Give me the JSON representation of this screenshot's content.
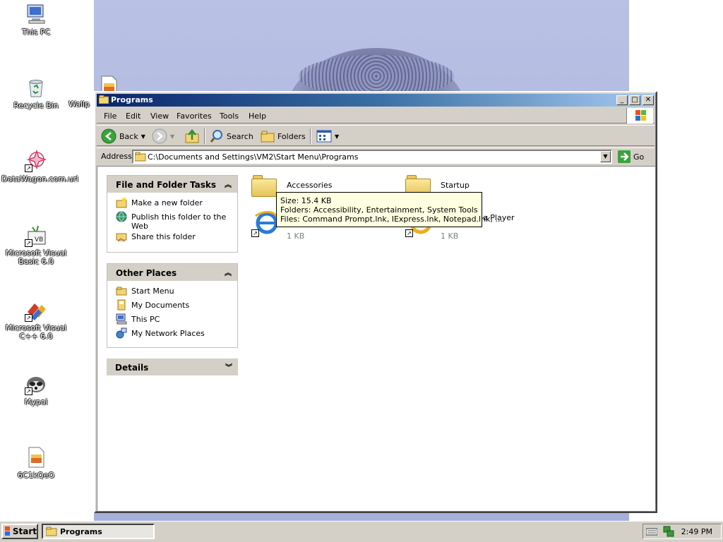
{
  "desktop": {
    "icons": [
      {
        "label": "This PC",
        "icon": "computer-icon"
      },
      {
        "label": "Recycle Bin",
        "icon": "recycle-bin-icon"
      },
      {
        "label": "Wallp",
        "icon": "image-file-icon"
      },
      {
        "label": "DataWagon.com.url",
        "icon": "url-shortcut-icon"
      },
      {
        "label": "Microsoft Visual Basic 6.0",
        "icon": "visual-basic-icon"
      },
      {
        "label": "Microsoft Visual C++ 6.0",
        "icon": "visual-cpp-icon"
      },
      {
        "label": "Mypal",
        "icon": "mypal-raccoon-icon"
      },
      {
        "label": "6C1kQeO",
        "icon": "image-file-icon"
      }
    ]
  },
  "window": {
    "title": "Programs",
    "menu": [
      "File",
      "Edit",
      "View",
      "Favorites",
      "Tools",
      "Help"
    ],
    "toolbar": {
      "back": "Back",
      "search": "Search",
      "folders": "Folders"
    },
    "address": {
      "label": "Address",
      "value": "C:\\Documents and Settings\\VM2\\Start Menu\\Programs",
      "go": "Go"
    }
  },
  "tasks": {
    "file_folder": {
      "title": "File and Folder Tasks",
      "items": [
        "Make a new folder",
        "Publish this folder to the Web",
        "Share this folder"
      ]
    },
    "other_places": {
      "title": "Other Places",
      "items": [
        "Start Menu",
        "My Documents",
        "This PC",
        "My Network Places"
      ]
    },
    "details": {
      "title": "Details"
    }
  },
  "files": [
    {
      "name": "Accessories",
      "size": ""
    },
    {
      "name": "Startup",
      "size": ""
    },
    {
      "name": "",
      "size": "1 KB"
    },
    {
      "name": "dia Player",
      "size": "1 KB"
    }
  ],
  "tooltip": {
    "size": "Size: 15.4 KB",
    "folders": "Folders: Accessibility, Entertainment, System Tools",
    "files": "Files: Command Prompt.lnk, IExpress.lnk, Notepad.lnk, ..."
  },
  "taskbar": {
    "start": "Start",
    "task": "Programs",
    "clock": "2:49 PM"
  },
  "colors": {
    "titlebar_start": "#0a246a",
    "titlebar_end": "#a6caf0",
    "tooltip_bg": "#ffffe1"
  }
}
